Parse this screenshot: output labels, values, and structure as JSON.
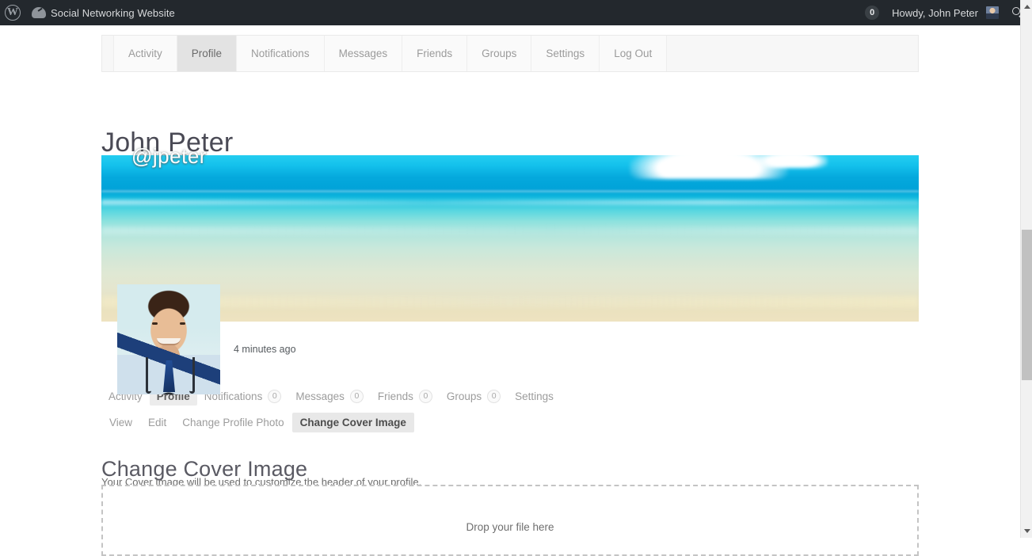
{
  "adminbar": {
    "wp_logo_letter": "W",
    "site_name": "Social Networking Website",
    "notification_count": "0",
    "howdy": "Howdy, John Peter",
    "icons": {
      "wordpress": "wordpress-logo-icon",
      "dashboard": "dashboard-icon",
      "search": "search-icon",
      "avatar": "user-avatar-icon"
    }
  },
  "primary_nav": {
    "items": [
      {
        "label": "Activity",
        "current": false
      },
      {
        "label": "Profile",
        "current": true
      },
      {
        "label": "Notifications",
        "current": false
      },
      {
        "label": "Messages",
        "current": false
      },
      {
        "label": "Friends",
        "current": false
      },
      {
        "label": "Groups",
        "current": false
      },
      {
        "label": "Settings",
        "current": false
      },
      {
        "label": "Log Out",
        "current": false
      }
    ]
  },
  "profile": {
    "display_name": "John Peter",
    "username": "@jpeter",
    "last_active": "4 minutes ago",
    "cover_image_alt": "beach-ocean-cover-photo",
    "avatar_alt": "john-peter-profile-photo"
  },
  "user_nav": {
    "items": [
      {
        "label": "Activity",
        "count": null,
        "current": false
      },
      {
        "label": "Profile",
        "count": null,
        "current": true
      },
      {
        "label": "Notifications",
        "count": "0",
        "current": false
      },
      {
        "label": "Messages",
        "count": "0",
        "current": false
      },
      {
        "label": "Friends",
        "count": "0",
        "current": false
      },
      {
        "label": "Groups",
        "count": "0",
        "current": false
      },
      {
        "label": "Settings",
        "count": null,
        "current": false
      }
    ]
  },
  "sub_nav": {
    "items": [
      {
        "label": "View",
        "current": false
      },
      {
        "label": "Edit",
        "current": false
      },
      {
        "label": "Change Profile Photo",
        "current": false
      },
      {
        "label": "Change Cover Image",
        "current": true
      }
    ]
  },
  "section": {
    "heading": "Change Cover Image",
    "description": "Your Cover Image will be used to customize the header of your profile."
  },
  "dropzone": {
    "label": "Drop your file here"
  },
  "colors": {
    "adminbar_bg": "#23282d",
    "page_bg": "#ffffff",
    "active_tab_bg": "#e3e3e3",
    "cover_top": "#24cdf0",
    "cover_mid": "#00a2d8",
    "cover_bottom": "#eee3c0",
    "muted_text": "#9c9c9c",
    "heading_text": "#4a4a55"
  }
}
